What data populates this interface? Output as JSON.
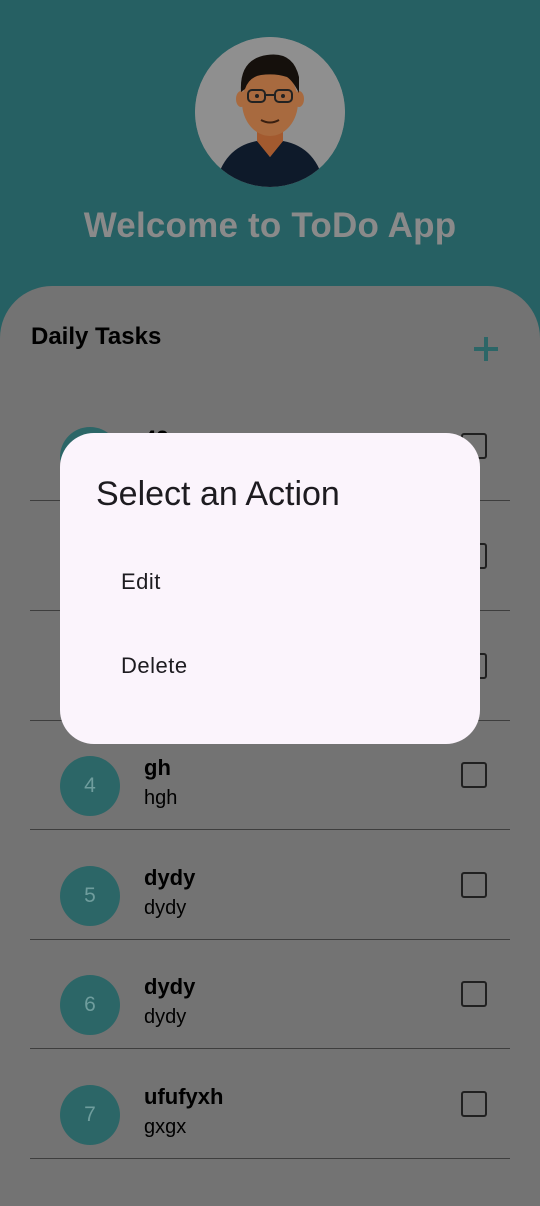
{
  "header": {
    "title": "Welcome to ToDo App"
  },
  "section": {
    "title": "Daily Tasks",
    "add_icon": "plus-icon"
  },
  "tasks": [
    {
      "num": "",
      "title": "42",
      "sub": ""
    },
    {
      "num": "",
      "title": "",
      "sub": ""
    },
    {
      "num": "",
      "title": "",
      "sub": ""
    },
    {
      "num": "4",
      "title": "gh",
      "sub": "hgh"
    },
    {
      "num": "5",
      "title": "dydy",
      "sub": "dydy"
    },
    {
      "num": "6",
      "title": "dydy",
      "sub": "dydy"
    },
    {
      "num": "7",
      "title": "ufufyxh",
      "sub": "gxgx"
    }
  ],
  "dialog": {
    "title": "Select an Action",
    "edit": "Edit",
    "delete": "Delete"
  },
  "colors": {
    "teal": "#266063",
    "scrim_card": "#737373",
    "dialog_bg": "#fbf4fc"
  }
}
